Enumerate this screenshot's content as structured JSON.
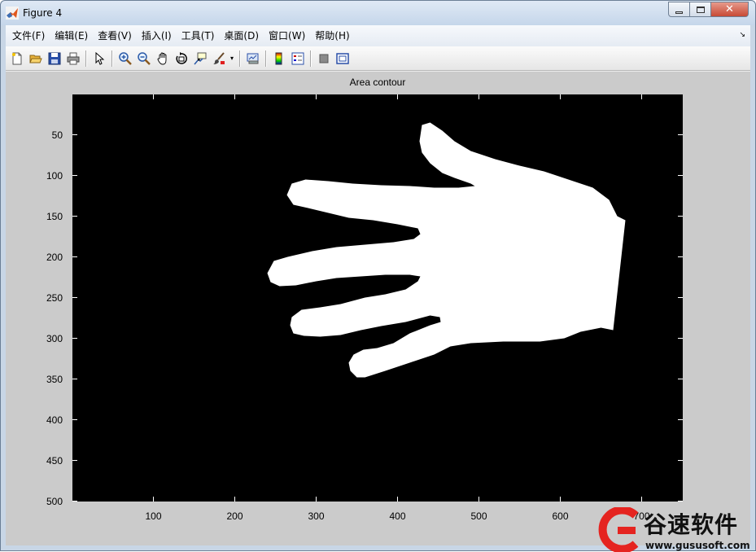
{
  "window": {
    "title": "Figure 4",
    "controls": {
      "minimize": "minimize",
      "maximize": "maximize",
      "close": "✕"
    }
  },
  "menubar": {
    "items": [
      "文件(F)",
      "编辑(E)",
      "查看(V)",
      "插入(I)",
      "工具(T)",
      "桌面(D)",
      "窗口(W)",
      "帮助(H)"
    ],
    "overflow_arrow": "↘"
  },
  "toolbar": {
    "buttons": [
      {
        "name": "new-figure",
        "icon": "new-file-icon"
      },
      {
        "name": "open-file",
        "icon": "folder-open-icon"
      },
      {
        "name": "save-figure",
        "icon": "floppy-disk-icon"
      },
      {
        "name": "print-figure",
        "icon": "printer-icon"
      },
      {
        "name": "edit-plot",
        "icon": "arrow-pointer-icon"
      },
      {
        "name": "zoom-in",
        "icon": "zoom-in-icon"
      },
      {
        "name": "zoom-out",
        "icon": "zoom-out-icon"
      },
      {
        "name": "pan",
        "icon": "hand-icon"
      },
      {
        "name": "rotate-3d",
        "icon": "rotate-3d-icon"
      },
      {
        "name": "data-cursor",
        "icon": "data-cursor-icon"
      },
      {
        "name": "brush",
        "icon": "brush-icon"
      },
      {
        "name": "link-plot",
        "icon": "link-plot-icon"
      },
      {
        "name": "insert-colorbar",
        "icon": "colorbar-icon"
      },
      {
        "name": "insert-legend",
        "icon": "legend-icon"
      },
      {
        "name": "hide-plot-tools",
        "icon": "hide-tools-icon"
      },
      {
        "name": "show-plot-tools",
        "icon": "show-tools-icon"
      }
    ]
  },
  "figure": {
    "axes_title": "Area contour",
    "image": {
      "type": "binary-mask",
      "background_color": "#000000",
      "foreground_color": "#ffffff",
      "subject": "hand-silhouette"
    },
    "x_axis": {
      "range": [
        0.5,
        750.5
      ],
      "ticks": [
        100,
        200,
        300,
        400,
        500,
        600,
        700
      ],
      "tick_labels": [
        "100",
        "200",
        "300",
        "400",
        "500",
        "600",
        "700"
      ]
    },
    "y_axis": {
      "range": [
        0.5,
        500.5
      ],
      "reversed": true,
      "ticks": [
        50,
        100,
        150,
        200,
        250,
        300,
        350,
        400,
        450,
        500
      ],
      "tick_labels": [
        "50",
        "100",
        "150",
        "200",
        "250",
        "300",
        "350",
        "400",
        "450",
        "500"
      ]
    },
    "hand_outline_data": [
      [
        430,
        38
      ],
      [
        440,
        35
      ],
      [
        455,
        45
      ],
      [
        470,
        58
      ],
      [
        490,
        70
      ],
      [
        520,
        80
      ],
      [
        550,
        88
      ],
      [
        580,
        95
      ],
      [
        610,
        105
      ],
      [
        640,
        115
      ],
      [
        660,
        130
      ],
      [
        670,
        150
      ],
      [
        680,
        155
      ],
      [
        665,
        290
      ],
      [
        650,
        287
      ],
      [
        625,
        292
      ],
      [
        605,
        300
      ],
      [
        575,
        304
      ],
      [
        530,
        304
      ],
      [
        490,
        306
      ],
      [
        465,
        310
      ],
      [
        445,
        320
      ],
      [
        415,
        330
      ],
      [
        385,
        340
      ],
      [
        360,
        348
      ],
      [
        350,
        348
      ],
      [
        342,
        340
      ],
      [
        340,
        330
      ],
      [
        346,
        320
      ],
      [
        358,
        314
      ],
      [
        375,
        312
      ],
      [
        395,
        306
      ],
      [
        415,
        294
      ],
      [
        440,
        284
      ],
      [
        453,
        280
      ],
      [
        452,
        274
      ],
      [
        440,
        272
      ],
      [
        410,
        280
      ],
      [
        380,
        285
      ],
      [
        355,
        290
      ],
      [
        330,
        296
      ],
      [
        305,
        298
      ],
      [
        285,
        297
      ],
      [
        272,
        294
      ],
      [
        268,
        284
      ],
      [
        270,
        274
      ],
      [
        282,
        265
      ],
      [
        305,
        262
      ],
      [
        330,
        258
      ],
      [
        360,
        250
      ],
      [
        385,
        246
      ],
      [
        410,
        240
      ],
      [
        425,
        230
      ],
      [
        428,
        224
      ],
      [
        415,
        222
      ],
      [
        385,
        222
      ],
      [
        355,
        224
      ],
      [
        325,
        226
      ],
      [
        300,
        230
      ],
      [
        275,
        235
      ],
      [
        255,
        236
      ],
      [
        244,
        231
      ],
      [
        240,
        220
      ],
      [
        248,
        205
      ],
      [
        265,
        200
      ],
      [
        295,
        193
      ],
      [
        325,
        188
      ],
      [
        360,
        185
      ],
      [
        395,
        182
      ],
      [
        420,
        178
      ],
      [
        428,
        172
      ],
      [
        425,
        165
      ],
      [
        400,
        160
      ],
      [
        370,
        155
      ],
      [
        340,
        152
      ],
      [
        315,
        146
      ],
      [
        290,
        140
      ],
      [
        272,
        136
      ],
      [
        264,
        124
      ],
      [
        270,
        110
      ],
      [
        287,
        105
      ],
      [
        315,
        107
      ],
      [
        345,
        110
      ],
      [
        380,
        112
      ],
      [
        415,
        113
      ],
      [
        445,
        115
      ],
      [
        475,
        115
      ],
      [
        495,
        113
      ],
      [
        490,
        110
      ],
      [
        470,
        103
      ],
      [
        455,
        97
      ],
      [
        440,
        85
      ],
      [
        430,
        72
      ],
      [
        427,
        58
      ]
    ]
  },
  "watermark": {
    "brand_cn": "谷速软件",
    "url": "www.gususoft.com"
  }
}
